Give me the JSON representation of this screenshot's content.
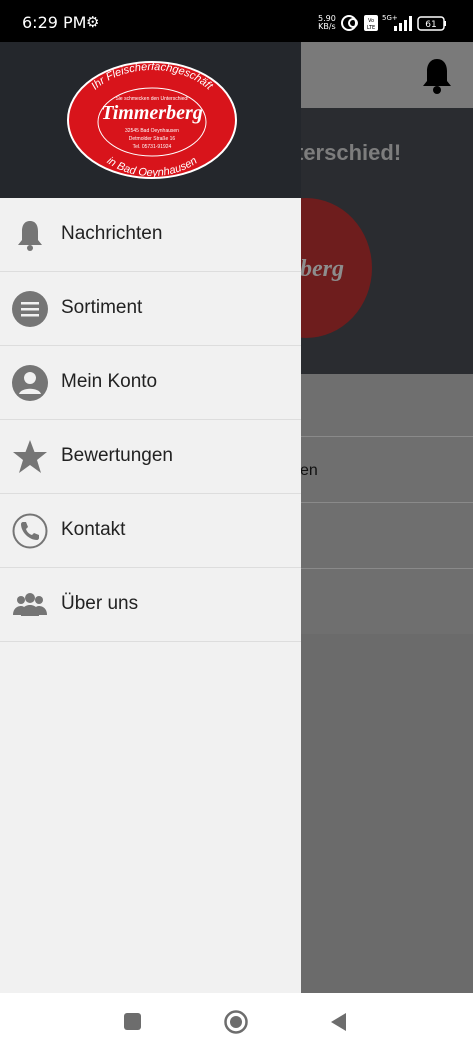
{
  "status_bar": {
    "time": "6:29 PM",
    "network_speed_value": "5.90",
    "network_speed_unit": "KB/s",
    "network_type": "5G+",
    "battery": "61"
  },
  "background_page": {
    "banner_text": "terschied!",
    "list_fragment": "en",
    "logo_fragment": "berg"
  },
  "drawer": {
    "logo": {
      "arc_top": "Ihr Fleischerfachgeschäft",
      "tagline": "Sie schmecken den Unterschied!",
      "name": "Timmerberg",
      "address_city": "32545 Bad Oeynhausen",
      "address_street": "Detmolder Straße 16",
      "phone": "Tel. 05731-91924",
      "arc_bottom": "in Bad Oeynhausen"
    },
    "items": [
      {
        "label": "Nachrichten",
        "icon": "bell-icon"
      },
      {
        "label": "Sortiment",
        "icon": "list-icon"
      },
      {
        "label": "Mein Konto",
        "icon": "account-icon"
      },
      {
        "label": "Bewertungen",
        "icon": "star-icon"
      },
      {
        "label": "Kontakt",
        "icon": "phone-icon"
      },
      {
        "label": "Über uns",
        "icon": "group-icon"
      }
    ]
  },
  "colors": {
    "drawer_bg": "#f1f1f1",
    "icon_gray": "#757575",
    "logo_red": "#d8141b",
    "scrim": "#6b6b6b"
  }
}
